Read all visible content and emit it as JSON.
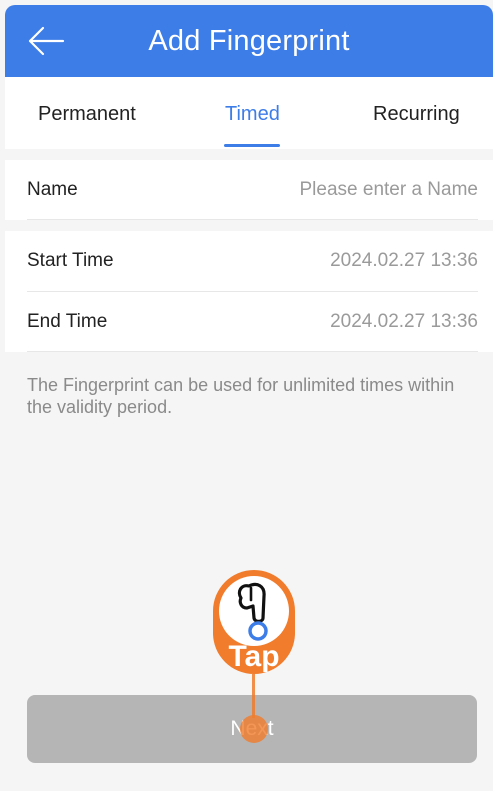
{
  "header": {
    "title": "Add Fingerprint",
    "back_icon": "arrow-left-icon"
  },
  "tabs": [
    {
      "label": "Permanent",
      "active": false
    },
    {
      "label": "Timed",
      "active": true
    },
    {
      "label": "Recurring",
      "active": false
    }
  ],
  "form": {
    "name_label": "Name",
    "name_placeholder": "Please enter a Name",
    "start_label": "Start Time",
    "start_value": "2024.02.27 13:36",
    "end_label": "End Time",
    "end_value": "2024.02.27 13:36"
  },
  "info_text": "The Fingerprint can be used for unlimited times within the validity period.",
  "next_label": "Next",
  "overlay": {
    "tap_label": "Tap",
    "icon": "hand-pointer-icon"
  },
  "colors": {
    "accent": "#3d7de8",
    "overlay": "#f07c2c",
    "button_disabled": "#b5b5b5"
  }
}
